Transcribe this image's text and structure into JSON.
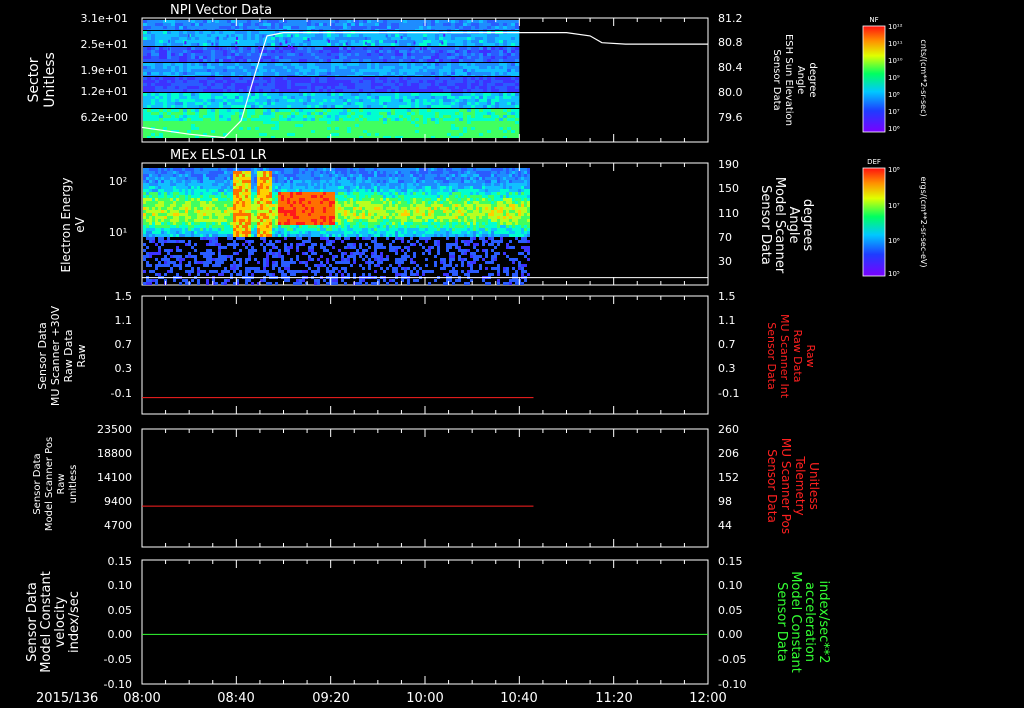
{
  "figure": {
    "date_label": "2015/136",
    "time_ticks": [
      "08:00",
      "08:40",
      "09:20",
      "10:00",
      "10:40",
      "11:20",
      "12:00"
    ],
    "colors": {
      "background": "#000000",
      "foreground": "#ffffff",
      "red": "#ff2020",
      "green": "#33ff33"
    }
  },
  "panels": [
    {
      "title": "NPI Vector Data",
      "left_label": [
        "Sector",
        "Unitless"
      ],
      "left_ticks": [
        "3.1e+01",
        "2.5e+01",
        "1.9e+01",
        "1.2e+01",
        "6.2e+00"
      ],
      "right_label": [
        "Sensor Data",
        "ESH Sun Elevation",
        "Angle",
        "degree"
      ],
      "right_ticks": [
        "81.2",
        "80.8",
        "80.4",
        "80.0",
        "79.6"
      ],
      "colorbar_title": "NF",
      "colorbar_ticks": [
        "10¹²",
        "10¹¹",
        "10¹⁰",
        "10⁹",
        "10⁸",
        "10⁷",
        "10⁶"
      ],
      "colorbar_unit": "cnts/(cm**2-sr-sec)"
    },
    {
      "title": "MEx ELS-01 LR",
      "left_label": [
        "Electron Energy",
        "eV"
      ],
      "left_ticks": [
        "10²",
        "10¹"
      ],
      "right_label": [
        "Sensor Data",
        "Model Scanner",
        "Angle",
        "degrees"
      ],
      "right_ticks": [
        "190",
        "150",
        "110",
        "70",
        "30"
      ],
      "colorbar_title": "DEF",
      "colorbar_ticks": [
        "10⁸",
        "10⁷",
        "10⁶",
        "10⁵"
      ],
      "colorbar_unit": "ergs/(cm**2-sr-sec-eV)"
    },
    {
      "left_label": [
        "Sensor Data",
        "MU Scanner +30V",
        "Raw Data",
        "Raw"
      ],
      "left_ticks": [
        "1.5",
        "1.1",
        "0.7",
        "0.3",
        "-0.1"
      ],
      "right_label": [
        "Sensor Data",
        "MU Scanner Int",
        "Raw Data",
        "Raw"
      ],
      "right_ticks": [
        "1.5",
        "1.1",
        "0.7",
        "0.3",
        "-0.1"
      ]
    },
    {
      "left_label": [
        "Sensor Data",
        "Model Scanner Pos",
        "Raw",
        "unitless"
      ],
      "left_ticks": [
        "23500",
        "18800",
        "14100",
        "9400",
        "4700"
      ],
      "right_label": [
        "Sensor Data",
        "MU Scanner Pos",
        "Telemetry",
        "Unitless"
      ],
      "right_ticks": [
        "260",
        "206",
        "152",
        "98",
        "44"
      ]
    },
    {
      "left_label": [
        "Sensor Data",
        "Model Constant",
        "velocity",
        "index/sec"
      ],
      "left_ticks": [
        "0.15",
        "0.10",
        "0.05",
        "0.00",
        "-0.05",
        "-0.10"
      ],
      "right_label": [
        "Sensor Data",
        "Model Constant",
        "acceleration",
        "index/sec**2"
      ],
      "right_ticks": [
        "0.15",
        "0.10",
        "0.05",
        "0.00",
        "-0.05",
        "-0.10"
      ]
    }
  ],
  "chart_data": [
    {
      "type": "heatmap",
      "title": "NPI Vector Data",
      "x_range": [
        "08:00",
        "12:00"
      ],
      "data_end": "10:40",
      "y_range": [
        0,
        31
      ],
      "ylabel": "Sector Unitless",
      "overlay_line": {
        "name": "ESH Sun Elevation Angle",
        "ylim": [
          79.4,
          81.2
        ],
        "points": [
          [
            "08:00",
            79.6
          ],
          [
            "08:20",
            79.5
          ],
          [
            "08:35",
            79.45
          ],
          [
            "08:42",
            79.7
          ],
          [
            "08:48",
            80.4
          ],
          [
            "08:53",
            80.95
          ],
          [
            "09:00",
            81.0
          ],
          [
            "10:00",
            81.0
          ],
          [
            "11:00",
            81.0
          ],
          [
            "11:10",
            80.95
          ],
          [
            "11:15",
            80.85
          ],
          [
            "11:25",
            80.83
          ],
          [
            "12:00",
            80.83
          ]
        ]
      }
    },
    {
      "type": "heatmap",
      "title": "MEx ELS-01 LR",
      "x_range": [
        "08:00",
        "12:00"
      ],
      "data_end": "10:44",
      "ylabel": "Electron Energy eV",
      "yscale": "log",
      "ylim": [
        1,
        200
      ],
      "overlay_line": {
        "name": "Model Scanner Angle",
        "value": 10,
        "ylim": [
          0,
          190
        ]
      }
    },
    {
      "type": "line",
      "ylim": [
        -0.3,
        1.5
      ],
      "series": [
        {
          "color": "#ff2020",
          "x": [
            "08:00",
            "10:46"
          ],
          "values": [
            -0.05,
            -0.05
          ]
        }
      ]
    },
    {
      "type": "line",
      "ylim": [
        0,
        23500
      ],
      "series": [
        {
          "color": "#ff2020",
          "x": [
            "08:00",
            "10:46"
          ],
          "values": [
            8140,
            8140
          ]
        }
      ]
    },
    {
      "type": "line",
      "ylim": [
        -0.1,
        0.15
      ],
      "series": [
        {
          "color": "#33ff33",
          "x": [
            "08:00",
            "12:00"
          ],
          "values": [
            0.0,
            0.0
          ]
        }
      ]
    }
  ]
}
